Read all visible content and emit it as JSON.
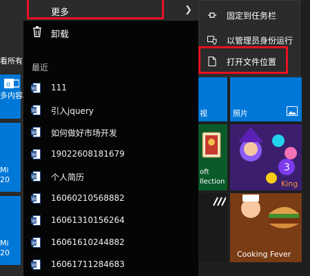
{
  "context_menu": {
    "more_label": "更多",
    "uninstall_label": "卸载"
  },
  "submenu": {
    "items": [
      {
        "label": "固定到任务栏"
      },
      {
        "label": "以管理员身份运行"
      },
      {
        "label": "打开文件位置"
      }
    ]
  },
  "recent": {
    "title": "最近",
    "items": [
      {
        "label": "111"
      },
      {
        "label": "引入jquery"
      },
      {
        "label": "如何做好市场开发"
      },
      {
        "label": "19022608181679"
      },
      {
        "label": "个人简历"
      },
      {
        "label": "16060210568882"
      },
      {
        "label": "16061310156264"
      },
      {
        "label": "16061610244882"
      },
      {
        "label": "16061711284683"
      }
    ]
  },
  "left_tiles": {
    "line1": "看所有",
    "line2": "多内容。",
    "mi_a": "Mi",
    "num_a": "20",
    "mi_b": "Mi",
    "num_b": "20"
  },
  "right_tiles": {
    "video_label": "视",
    "photos_label": "照片",
    "solitaire_label1": "oft",
    "solitaire_label2": "llection",
    "cooking_label": "Cooking Fever"
  },
  "colors": {
    "accent": "#0078d7",
    "highlight_border": "#e81123"
  }
}
